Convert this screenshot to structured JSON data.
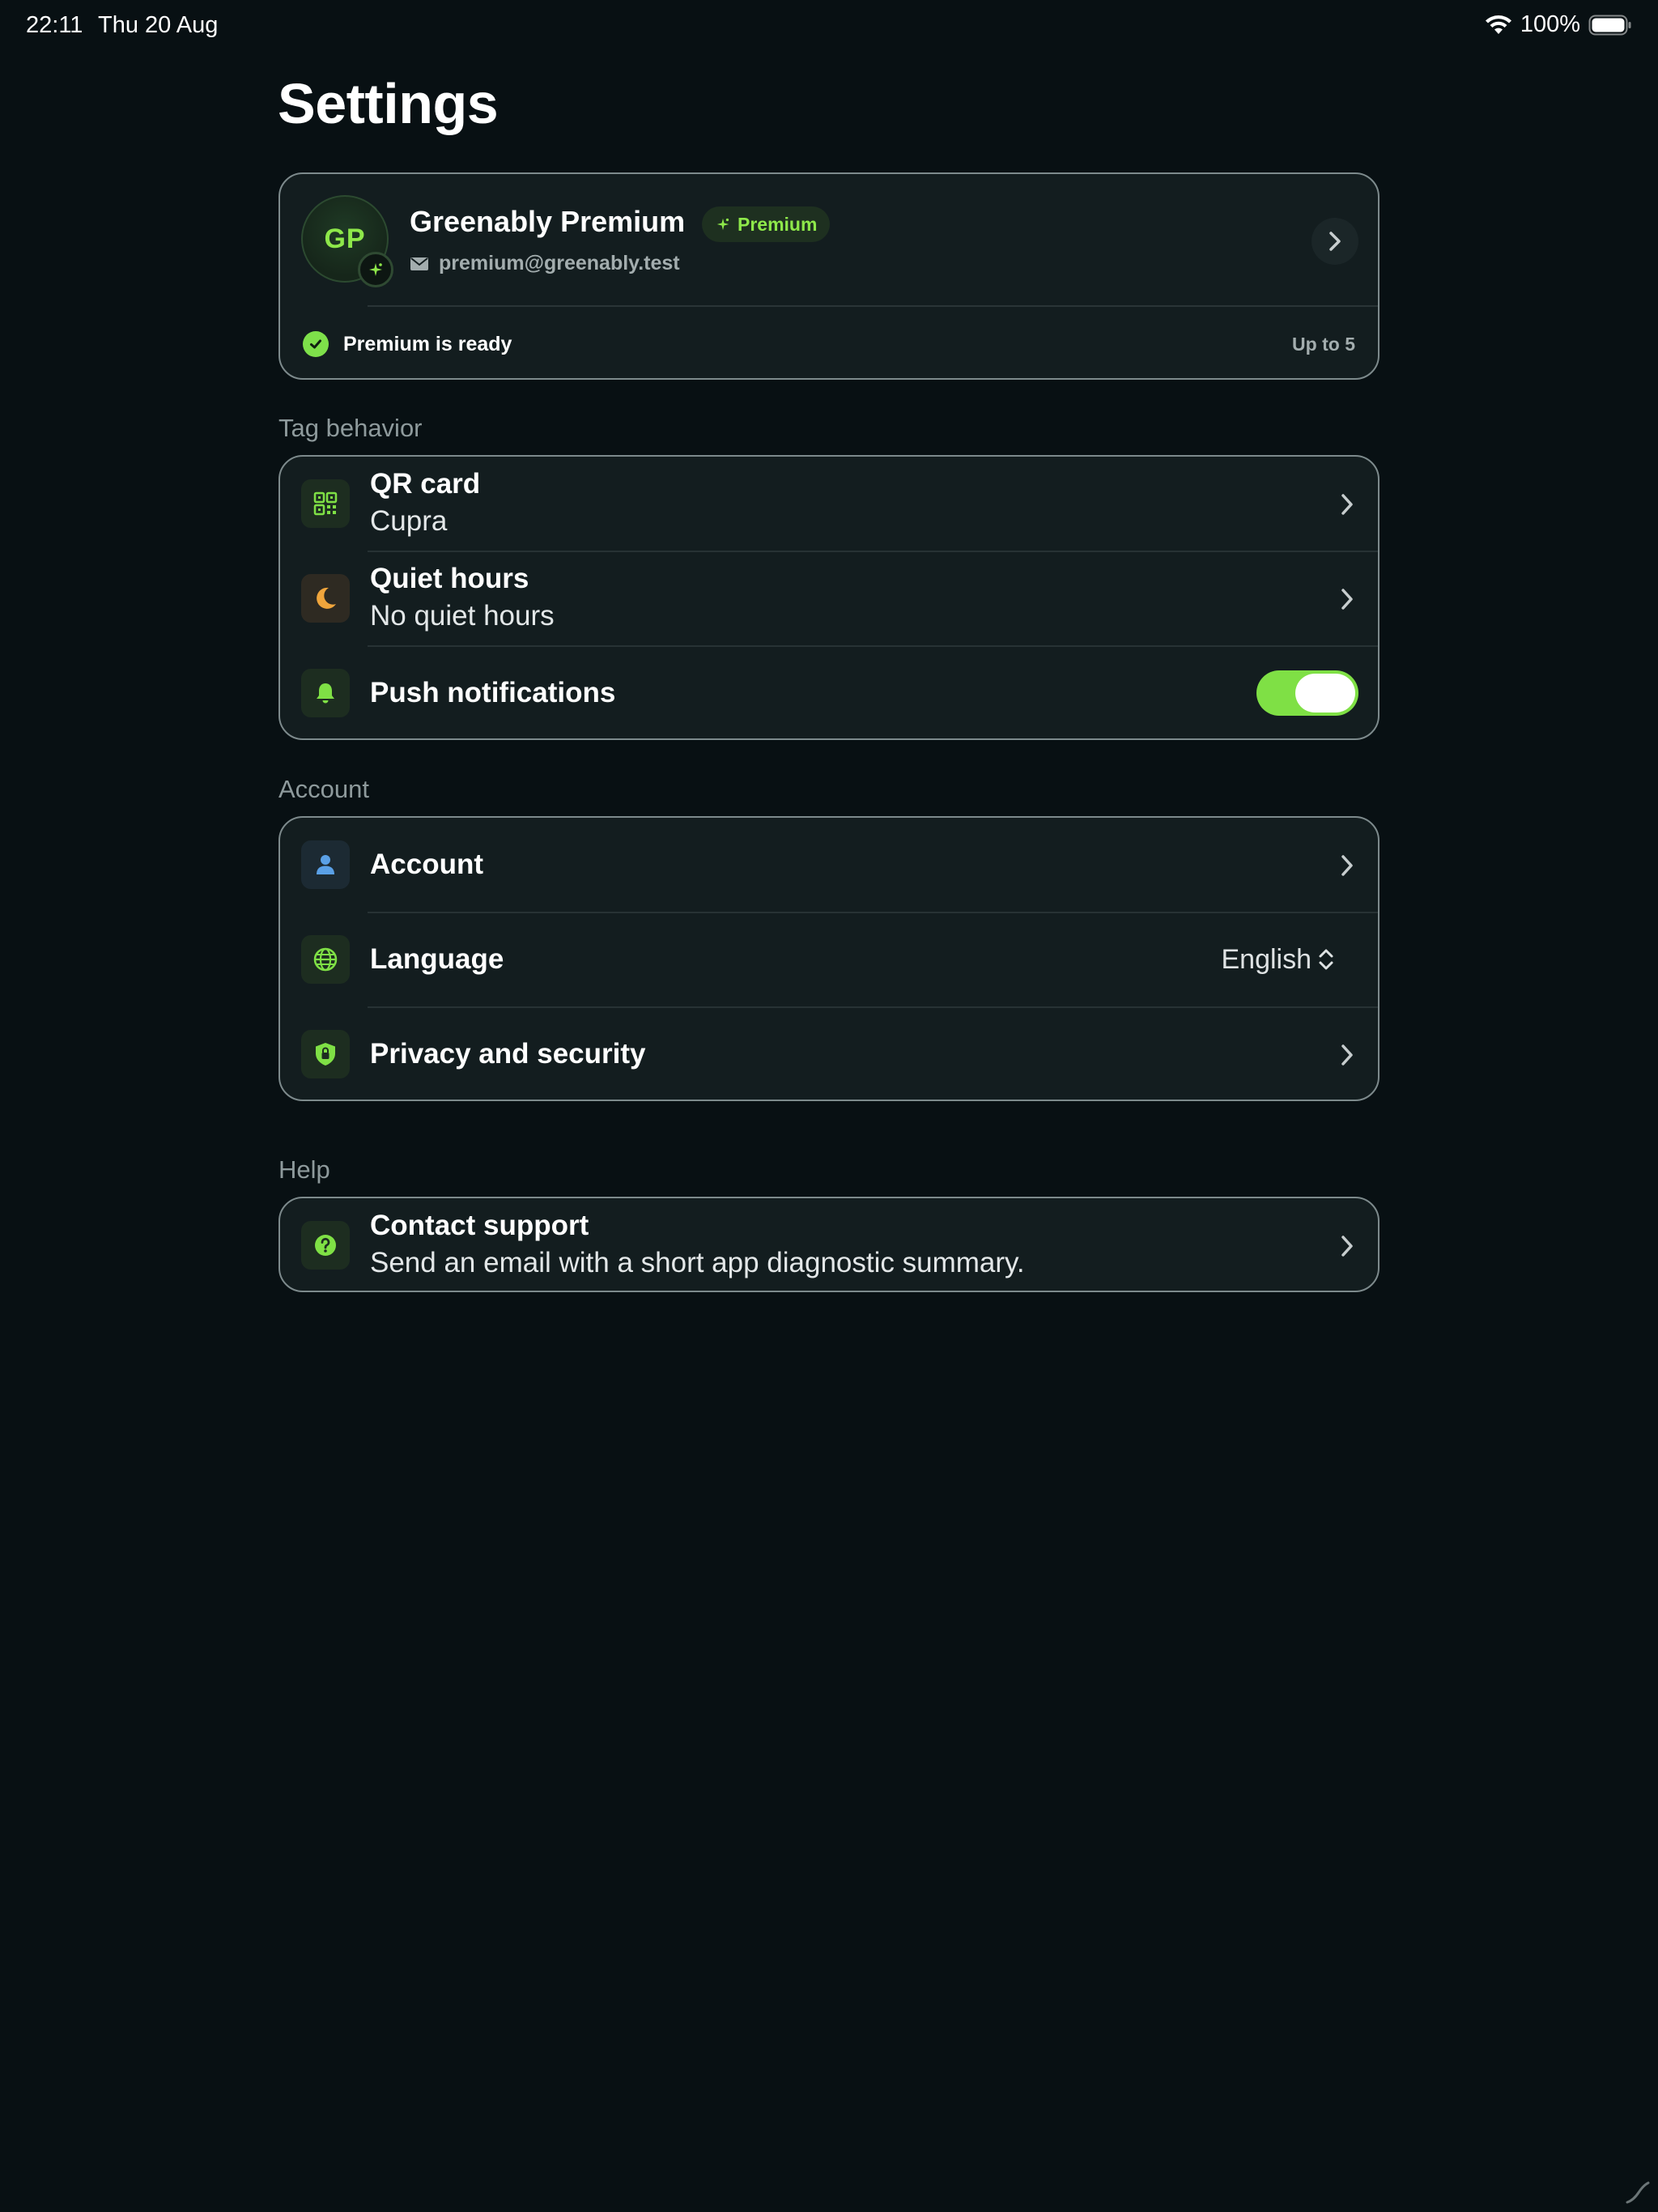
{
  "status_bar": {
    "time": "22:11",
    "date": "Thu 20 Aug",
    "battery": "100%"
  },
  "page": {
    "title": "Settings"
  },
  "profile": {
    "initials": "GP",
    "name": "Greenably Premium",
    "badge_label": "Premium",
    "email": "premium@greenably.test",
    "ready_text": "Premium is ready",
    "limit_text": "Up to 5"
  },
  "tag_behavior": {
    "section_label": "Tag behavior",
    "qr": {
      "title": "QR card",
      "subtitle": "Cupra"
    },
    "quiet": {
      "title": "Quiet hours",
      "subtitle": "No quiet hours"
    },
    "push": {
      "title": "Push notifications",
      "enabled": true
    }
  },
  "account_section": {
    "section_label": "Account",
    "account": {
      "title": "Account"
    },
    "language": {
      "title": "Language",
      "value": "English"
    },
    "privacy": {
      "title": "Privacy and security"
    }
  },
  "help": {
    "section_label": "Help",
    "support": {
      "title": "Contact support",
      "subtitle": "Send an email with a short app diagnostic summary."
    }
  },
  "colors": {
    "background": "#081013",
    "card": "#131d1f",
    "accent_green": "#7fe045",
    "border": "#7d8a8c"
  },
  "icons": [
    "wifi-icon",
    "battery-icon",
    "sparkle-icon",
    "mail-icon",
    "chevron-right-icon",
    "check-icon",
    "qr-code-icon",
    "moon-icon",
    "bell-icon",
    "person-icon",
    "globe-icon",
    "shield-lock-icon",
    "question-icon",
    "chevron-updown-icon"
  ]
}
